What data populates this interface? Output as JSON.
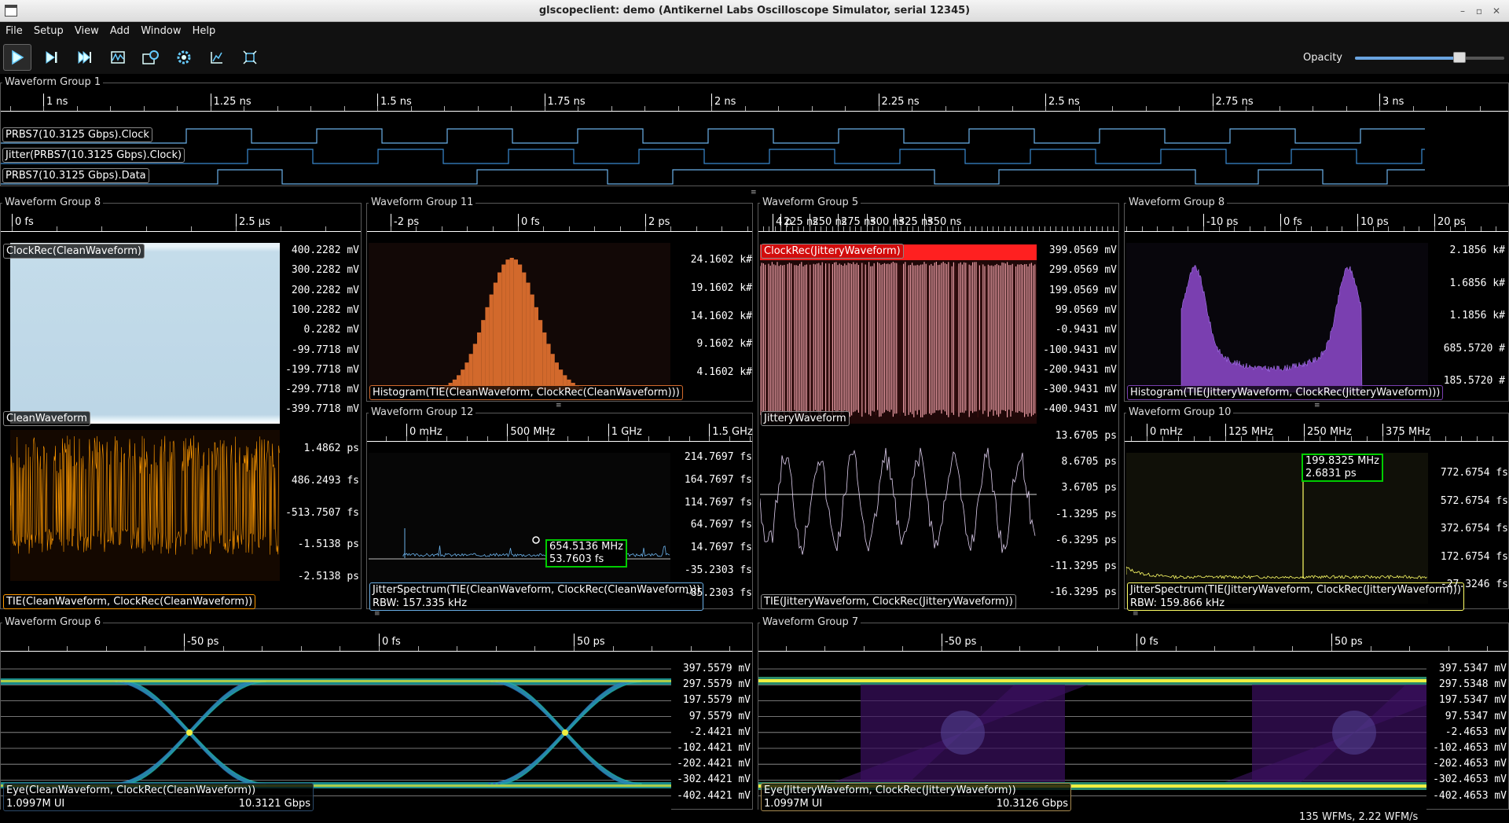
{
  "window": {
    "title": "glscopeclient: demo (Antikernel Labs Oscilloscope Simulator, serial 12345)"
  },
  "menu": [
    "File",
    "Setup",
    "View",
    "Add",
    "Window",
    "Help"
  ],
  "toolbar": {
    "buttons": [
      "start-icon",
      "single-trigger-icon",
      "force-trigger-icon",
      "history-icon",
      "refresh-icon",
      "settings-icon",
      "zoom-fit-icon",
      "fullscreen-icon"
    ],
    "opacity_label": "Opacity",
    "opacity_value": 0.7
  },
  "groups": {
    "g1": {
      "title": "Waveform Group 1",
      "ticks": [
        "1 ns",
        "1.25 ns",
        "1.5 ns",
        "1.75 ns",
        "2 ns",
        "2.25 ns",
        "2.5 ns",
        "2.75 ns",
        "3 ns"
      ],
      "channels": [
        "PRBS7(10.3125 Gbps).Clock",
        "Jitter(PRBS7(10.3125 Gbps).Clock)",
        "PRBS7(10.3125 Gbps).Data"
      ]
    },
    "g8a": {
      "title": "Waveform Group 8",
      "ticks": [
        "0 fs",
        "2.5 μs"
      ],
      "top_channel": "ClockRec(CleanWaveform)",
      "top_channel2": "CleanWaveform",
      "top_ylabels": [
        "400.2282 mV",
        "300.2282 mV",
        "200.2282 mV",
        "100.2282 mV",
        "0.2282 mV",
        "-99.7718 mV",
        "-199.7718 mV",
        "-299.7718 mV",
        "-399.7718 mV"
      ],
      "bottom_channel": "TIE(CleanWaveform, ClockRec(CleanWaveform))",
      "bottom_ylabels": [
        "1.4862 ps",
        "486.2493 fs",
        "-513.7507 fs",
        "-1.5138 ps",
        "-2.5138 ps"
      ]
    },
    "g11": {
      "title": "Waveform Group 11",
      "ticks": [
        "-2 ps",
        "0 fs",
        "2 ps",
        "4 p"
      ],
      "channel": "Histogram(TIE(CleanWaveform, ClockRec(CleanWaveform)))",
      "ylabels": [
        "24.1602 k#",
        "19.1602 k#",
        "14.1602 k#",
        "9.1602 k#",
        "4.1602 k#"
      ]
    },
    "g12": {
      "title": "Waveform Group 12",
      "ticks": [
        "0 mHz",
        "500 MHz",
        "1 GHz",
        "1.5 GHz"
      ],
      "channel": "JitterSpectrum(TIE(CleanWaveform, ClockRec(CleanWaveform)))",
      "rbw": "RBW: 157.335 kHz",
      "ylabels": [
        "214.7697 fs",
        "164.7697 fs",
        "114.7697 fs",
        "64.7697 fs",
        "14.7697 fs",
        "-35.2303 fs",
        "-85.2303 fs"
      ],
      "marker": [
        "654.5136 MHz",
        "53.7603 fs"
      ]
    },
    "g5": {
      "title": "Waveform Group 5",
      "ticks": [
        "225 ns",
        "250 ns",
        "275 ns",
        "300 ns",
        "325 ns",
        "350 ns"
      ],
      "top_channel": "ClockRec(JitteryWaveform)",
      "top_channel2": "JitteryWaveform",
      "top_ylabels": [
        "399.0569 mV",
        "299.0569 mV",
        "199.0569 mV",
        "99.0569 mV",
        "-0.9431 mV",
        "-100.9431 mV",
        "-200.9431 mV",
        "-300.9431 mV",
        "-400.9431 mV"
      ],
      "bottom_channel": "TIE(JitteryWaveform, ClockRec(JitteryWaveform))",
      "bottom_ylabels": [
        "13.6705 ps",
        "8.6705 ps",
        "3.6705 ps",
        "-1.3295 ps",
        "-6.3295 ps",
        "-11.3295 ps",
        "-16.3295 ps"
      ]
    },
    "g8b": {
      "title": "Waveform Group 8",
      "ticks": [
        "-10 ps",
        "0 fs",
        "10 ps",
        "20 ps"
      ],
      "channel": "Histogram(TIE(JitteryWaveform, ClockRec(JitteryWaveform)))",
      "ylabels": [
        "2.1856 k#",
        "1.6856 k#",
        "1.1856 k#",
        "685.5720 #",
        "185.5720 #"
      ]
    },
    "g10": {
      "title": "Waveform Group 10",
      "ticks": [
        "0 mHz",
        "125 MHz",
        "250 MHz",
        "375 MHz"
      ],
      "channel": "JitterSpectrum(TIE(JitteryWaveform, ClockRec(JitteryWaveform)))",
      "rbw": "RBW: 159.866 kHz",
      "ylabels": [
        "772.6754 fs",
        "572.6754 fs",
        "372.6754 fs",
        "172.6754 fs",
        "-27.3246 fs"
      ],
      "marker": [
        "199.8325 MHz",
        "2.6831 ps"
      ]
    },
    "g6": {
      "title": "Waveform Group 6",
      "ticks": [
        "-50 ps",
        "0 fs",
        "50 ps"
      ],
      "channel": "Eye(CleanWaveform, ClockRec(CleanWaveform))",
      "ui_count": "1.0997M UI",
      "rate": "10.3121 Gbps",
      "ylabels": [
        "397.5579 mV",
        "297.5579 mV",
        "197.5579 mV",
        "97.5579 mV",
        "-2.4421 mV",
        "-102.4421 mV",
        "-202.4421 mV",
        "-302.4421 mV",
        "-402.4421 mV"
      ]
    },
    "g7": {
      "title": "Waveform Group 7",
      "ticks": [
        "-50 ps",
        "0 fs",
        "50 ps"
      ],
      "channel": "Eye(JitteryWaveform, ClockRec(JitteryWaveform))",
      "ui_count": "1.0997M UI",
      "rate": "10.3126 Gbps",
      "ylabels": [
        "397.5347 mV",
        "297.5348 mV",
        "197.5347 mV",
        "97.5347 mV",
        "-2.4653 mV",
        "-102.4653 mV",
        "-202.4653 mV",
        "-302.4653 mV",
        "-402.4653 mV"
      ]
    }
  },
  "status": "135 WFMs, 2.22 WFM/s",
  "colors": {
    "clock": "#6ab0e8",
    "clean_fill": "#c4dcea",
    "tie_orange": "#ff9a00",
    "histogram_orange": "#d2692c",
    "histogram_purple": "#7a3fb0",
    "jittery_red": "#ff2020",
    "jittery_pink": "#f0a0a8",
    "spectrum_yellow": "#ffff66"
  }
}
